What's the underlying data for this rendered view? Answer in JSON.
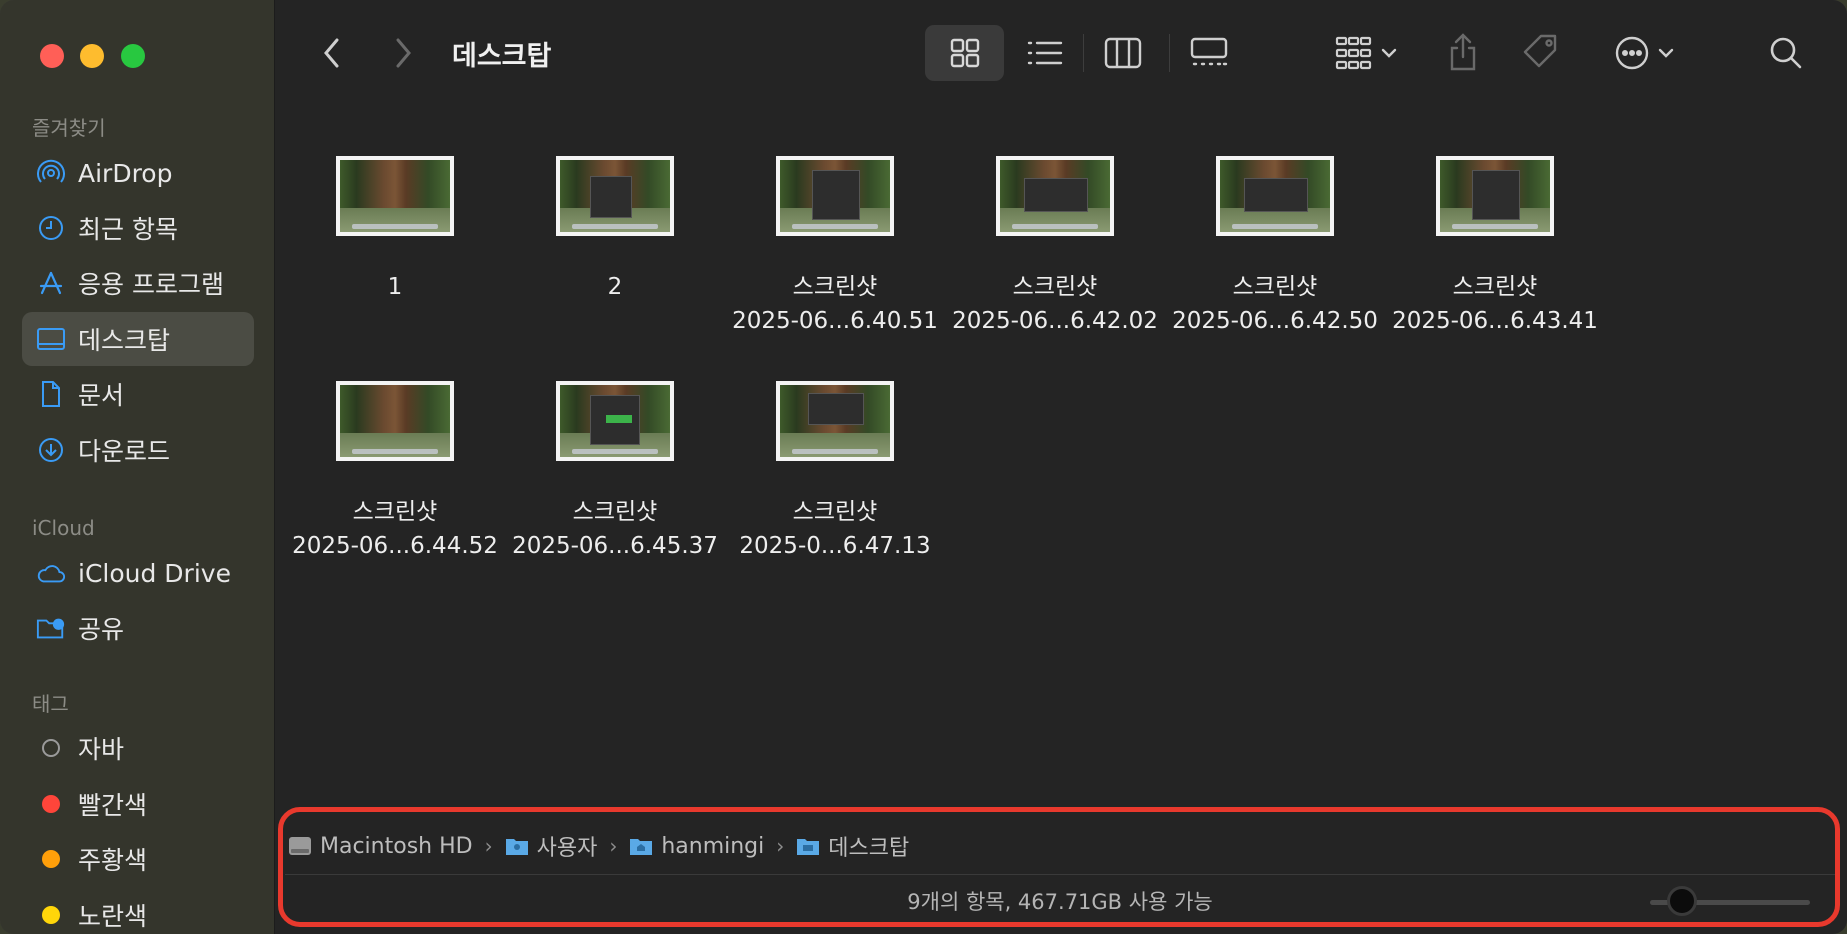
{
  "window": {
    "title": "데스크탑"
  },
  "sidebar": {
    "favorites_header": "즐겨찾기",
    "favorites": [
      {
        "label": "AirDrop",
        "icon": "airdrop-icon"
      },
      {
        "label": "최근 항목",
        "icon": "clock-icon"
      },
      {
        "label": "응용 프로그램",
        "icon": "applications-icon"
      },
      {
        "label": "데스크탑",
        "icon": "desktop-icon",
        "selected": true
      },
      {
        "label": "문서",
        "icon": "document-icon"
      },
      {
        "label": "다운로드",
        "icon": "download-icon"
      }
    ],
    "icloud_header": "iCloud",
    "icloud": [
      {
        "label": "iCloud Drive",
        "icon": "cloud-icon"
      },
      {
        "label": "공유",
        "icon": "shared-folder-icon"
      }
    ],
    "tags_header": "태그",
    "tags": [
      {
        "label": "자바",
        "color": ""
      },
      {
        "label": "빨간색",
        "color": "#ff453a"
      },
      {
        "label": "주황색",
        "color": "#ff9f0a"
      },
      {
        "label": "노란색",
        "color": "#ffd60a"
      }
    ]
  },
  "files": [
    {
      "line1": "1",
      "line2": ""
    },
    {
      "line1": "2",
      "line2": ""
    },
    {
      "line1": "스크린샷",
      "line2": "2025-06...6.40.51"
    },
    {
      "line1": "스크린샷",
      "line2": "2025-06...6.42.02"
    },
    {
      "line1": "스크린샷",
      "line2": "2025-06...6.42.50"
    },
    {
      "line1": "스크린샷",
      "line2": "2025-06...6.43.41"
    },
    {
      "line1": "스크린샷",
      "line2": "2025-06...6.44.52"
    },
    {
      "line1": "스크린샷",
      "line2": "2025-06...6.45.37"
    },
    {
      "line1": "스크린샷",
      "line2": "2025-0...6.47.13"
    }
  ],
  "pathbar": {
    "crumbs": [
      "Macintosh HD",
      "사용자",
      "hanmingi",
      "데스크탑"
    ]
  },
  "status": {
    "text": "9개의 항목, 467.71GB 사용 가능",
    "icon_size_level": 0.2
  },
  "colors": {
    "highlight": "#e8392d",
    "accent": "#3a9bf5"
  }
}
